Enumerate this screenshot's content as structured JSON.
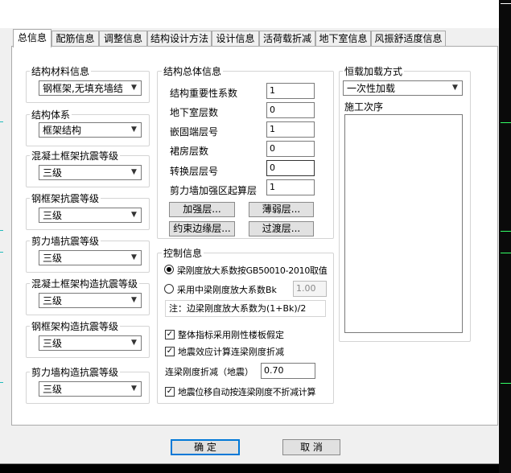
{
  "tabs": [
    {
      "label": "总信息"
    },
    {
      "label": "配筋信息"
    },
    {
      "label": "调整信息"
    },
    {
      "label": "结构设计方法"
    },
    {
      "label": "设计信息"
    },
    {
      "label": "活荷载折减"
    },
    {
      "label": "地下室信息"
    },
    {
      "label": "风振舒适度信息"
    }
  ],
  "left_groups": [
    {
      "title": "结构材料信息",
      "value": "钢框架,无填充墙结"
    },
    {
      "title": "结构体系",
      "value": "框架结构"
    },
    {
      "title": "混凝土框架抗震等级",
      "value": "三级"
    },
    {
      "title": "钢框架抗震等级",
      "value": "三级"
    },
    {
      "title": "剪力墙抗震等级",
      "value": "三级"
    },
    {
      "title": "混凝土框架构造抗震等级",
      "value": "三级"
    },
    {
      "title": "钢框架构造抗震等级",
      "value": "三级"
    },
    {
      "title": "剪力墙构造抗震等级",
      "value": "三级"
    }
  ],
  "overall": {
    "title": "结构总体信息",
    "fields": [
      {
        "label": "结构重要性系数",
        "value": "1"
      },
      {
        "label": "地下室层数",
        "value": "0"
      },
      {
        "label": "嵌固端层号",
        "value": "1"
      },
      {
        "label": "裙房层数",
        "value": "0"
      },
      {
        "label": "转换层层号",
        "value": "0"
      },
      {
        "label": "剪力墙加强区起算层",
        "value": "1"
      }
    ],
    "buttons": [
      "加强层...",
      "薄弱层...",
      "约束边缘层...",
      "过渡层..."
    ]
  },
  "control": {
    "title": "控制信息",
    "radio1": "梁刚度放大系数按GB50010-2010取值",
    "radio2": "采用中梁刚度放大系数Bk",
    "bk_value": "1.00",
    "note": "注：边梁刚度放大系数为(1+Bk)/2",
    "check1": "整体指标采用刚性楼板假定",
    "check2": "地震效应计算连梁刚度折减",
    "reduction_label": "连梁刚度折减（地震）",
    "reduction_value": "0.70",
    "check3": "地震位移自动按连梁刚度不折减计算"
  },
  "dead_load": {
    "title": "恒载加载方式",
    "value": "一次性加载",
    "sequence_label": "施工次序"
  },
  "footer": {
    "ok": "确  定",
    "cancel": "取  消"
  }
}
